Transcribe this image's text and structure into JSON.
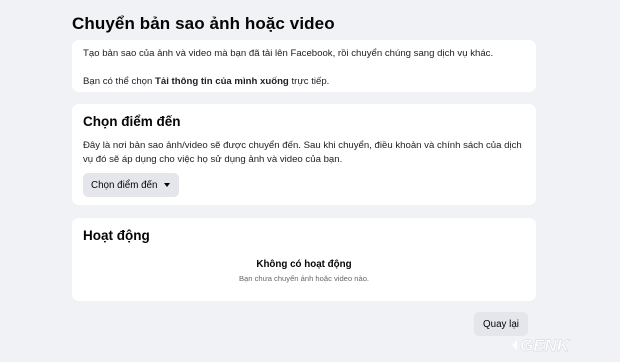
{
  "page": {
    "title": "Chuyển bản sao ảnh hoặc video"
  },
  "intro": {
    "line1": "Tạo bản sao của ảnh và video mà bạn đã tải lên Facebook, rồi chuyển chúng sang dịch vụ khác.",
    "line2_prefix": "Bạn có thể chọn ",
    "line2_link": "Tải thông tin của mình xuống",
    "line2_suffix": " trực tiếp."
  },
  "destination": {
    "heading": "Chọn điểm đến",
    "description": "Đây là nơi bản sao ảnh/video sẽ được chuyển đến. Sau khi chuyển, điều khoản và chính sách của dịch vụ đó sẽ áp dụng cho việc họ sử dụng ảnh và video của bạn.",
    "button_label": "Chọn điểm đến"
  },
  "activity": {
    "heading": "Hoạt động",
    "empty_title": "Không có hoạt động",
    "empty_subtitle": "Bạn chưa chuyển ảnh hoặc video nào."
  },
  "footer": {
    "back_label": "Quay lại"
  },
  "watermark": {
    "text": "GENK"
  },
  "colors": {
    "background": "#f0f2f5",
    "card": "#ffffff",
    "button": "#e4e6eb",
    "text_primary": "#050505",
    "text_secondary": "#65676b"
  }
}
